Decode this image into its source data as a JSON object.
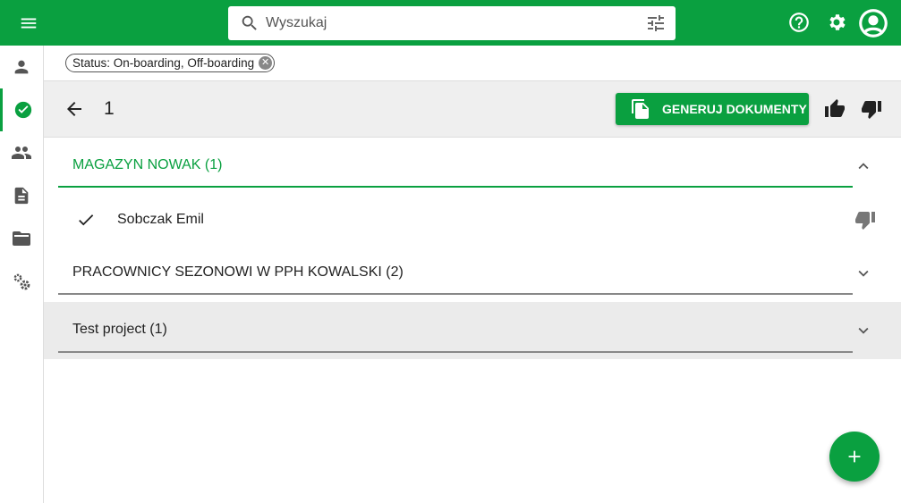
{
  "colors": {
    "brand": "#0aa040",
    "toolbar_bg": "#efefef",
    "highlight_row": "#ebebeb"
  },
  "header": {
    "search_placeholder": "Wyszukaj",
    "icons": [
      "menu-icon",
      "search-icon",
      "tune-icon",
      "help-icon",
      "gear-icon",
      "account-icon"
    ]
  },
  "sidebar": {
    "items": [
      {
        "icon": "person-icon",
        "active": false
      },
      {
        "icon": "check-circle-icon",
        "active": true
      },
      {
        "icon": "people-icon",
        "active": false
      },
      {
        "icon": "document-icon",
        "active": false
      },
      {
        "icon": "folder-open-icon",
        "active": false
      },
      {
        "icon": "settings-cogs-icon",
        "active": false
      }
    ]
  },
  "filters": {
    "chip_label": "Status: On-boarding, Off-boarding"
  },
  "toolbar": {
    "title": "1",
    "generate_label": "GENERUJ DOKUMENTY"
  },
  "groups": [
    {
      "title": "MAGAZYN NOWAK (1)",
      "expanded": true,
      "members": [
        {
          "name": "Sobczak Emil",
          "checked": true
        }
      ]
    },
    {
      "title": "PRACOWNICY SEZONOWI W PPH KOWALSKI (2)",
      "expanded": false
    },
    {
      "title": "Test project (1)",
      "expanded": false,
      "highlighted": true
    }
  ],
  "fab": {
    "icon": "plus-icon"
  }
}
